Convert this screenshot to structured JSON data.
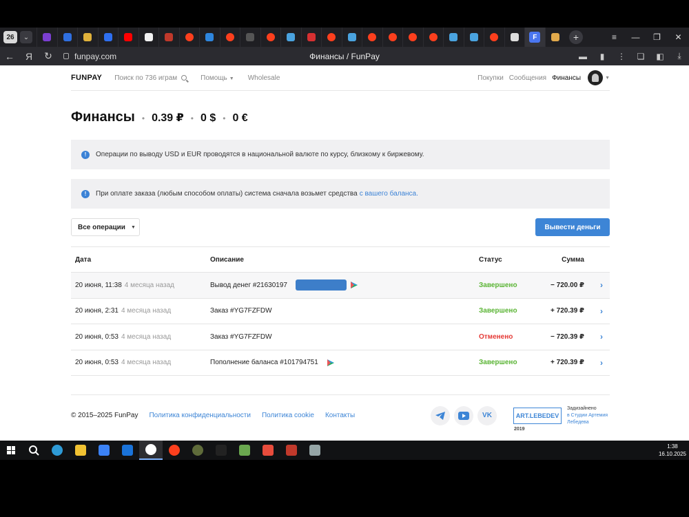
{
  "browser": {
    "tab_count": "26",
    "url": "funpay.com",
    "page_title": "Финансы / FunPay"
  },
  "header": {
    "logo": "FUNPAY",
    "search_label": "Поиск по 736 играм",
    "help_label": "Помощь",
    "wholesale_label": "Wholesale",
    "purchases_label": "Покупки",
    "messages_label": "Сообщения",
    "finances_label": "Финансы"
  },
  "finances": {
    "title": "Финансы",
    "balance_rub": "0.39 ₽",
    "balance_usd": "0 $",
    "balance_eur": "0 €"
  },
  "alerts": {
    "alert1": "Операции по выводу USD и EUR проводятся в национальной валюте по курсу, близкому к биржевому.",
    "alert2_text": "При оплате заказа (любым способом оплаты) система сначала возьмет средства",
    "alert2_link": "с вашего баланса."
  },
  "controls": {
    "filter_label": "Все операции",
    "withdraw_label": "Вывести деньги"
  },
  "table": {
    "headers": {
      "date": "Дата",
      "description": "Описание",
      "status": "Статус",
      "amount": "Сумма"
    },
    "rows": [
      {
        "date": "20 июня, 11:38",
        "ago": "4 месяца назад",
        "description": "Вывод денег #21630197",
        "status": "Завершено",
        "amount": "− 720.00 ₽"
      },
      {
        "date": "20 июня, 2:31",
        "ago": "4 месяца назад",
        "description": "Заказ #YG7FZFDW",
        "status": "Завершено",
        "amount": "+ 720.39 ₽"
      },
      {
        "date": "20 июня, 0:53",
        "ago": "4 месяца назад",
        "description": "Заказ #YG7FZFDW",
        "status": "Отменено",
        "amount": "− 720.39 ₽"
      },
      {
        "date": "20 июня, 0:53",
        "ago": "4 месяца назад",
        "description": "Пополнение баланса #101794751",
        "status": "Завершено",
        "amount": "+ 720.39 ₽"
      }
    ]
  },
  "footer": {
    "copyright": "© 2015–2025 FunPay",
    "privacy": "Политика конфиденциальности",
    "cookie": "Политика cookie",
    "contacts": "Контакты",
    "artlebedev_logo": "ART.LEBEDEV",
    "artlebedev_year": "2019",
    "designed_label": "Задизайнено",
    "designed_by": "в Студии Артемия Лебедева"
  },
  "taskbar": {
    "time": "1:38",
    "date": "16.10.2025"
  },
  "colors": {
    "accent": "#3d85d6",
    "success": "#5ab434",
    "danger": "#e53935"
  }
}
